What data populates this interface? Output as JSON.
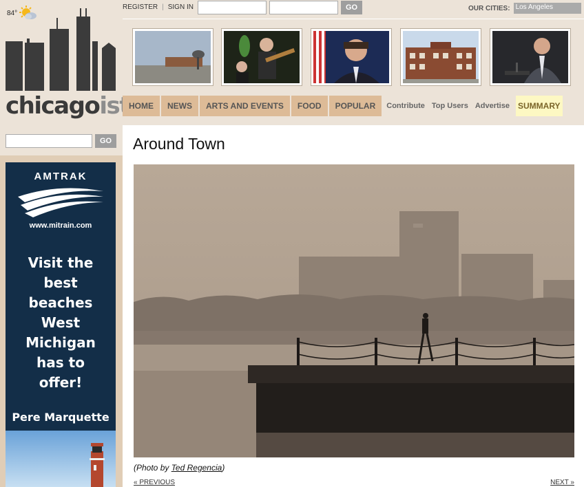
{
  "site": {
    "logo_main": "chicago",
    "logo_suffix": "ist",
    "weather_temp": "84°",
    "weather_icon": "partly-cloudy-icon"
  },
  "topbar": {
    "register": "REGISTER",
    "separator": "|",
    "sign_in": "SIGN IN",
    "login_go": "GO",
    "cities_label": "OUR CITIES:",
    "cities_selected": "Los Angeles"
  },
  "nav": {
    "tabs": [
      "HOME",
      "NEWS",
      "ARTS AND EVENTS",
      "FOOD",
      "POPULAR"
    ],
    "links": [
      "Contribute",
      "Top Users",
      "Advertise"
    ],
    "summary": "SUMMARY"
  },
  "search": {
    "go": "GO"
  },
  "ad": {
    "brand": "AMTRAK",
    "url": "www.mitrain.com",
    "tagline": [
      "Visit the",
      "best",
      "beaches",
      "West",
      "Michigan",
      "has to",
      "offer!"
    ],
    "route": "Pere Marquette",
    "colors": {
      "background": "#132e48"
    }
  },
  "article": {
    "title": "Around Town",
    "caption_prefix": "(Photo by ",
    "caption_author": "Ted Regencia",
    "caption_suffix": ")",
    "prev": "« PREVIOUS",
    "next": "NEXT »"
  },
  "colors": {
    "page_bg": "#ece3d8",
    "tab_bg": "#ddbb97",
    "summary_bg": "#fdf8c3",
    "button_gray": "#9e9e9e"
  }
}
